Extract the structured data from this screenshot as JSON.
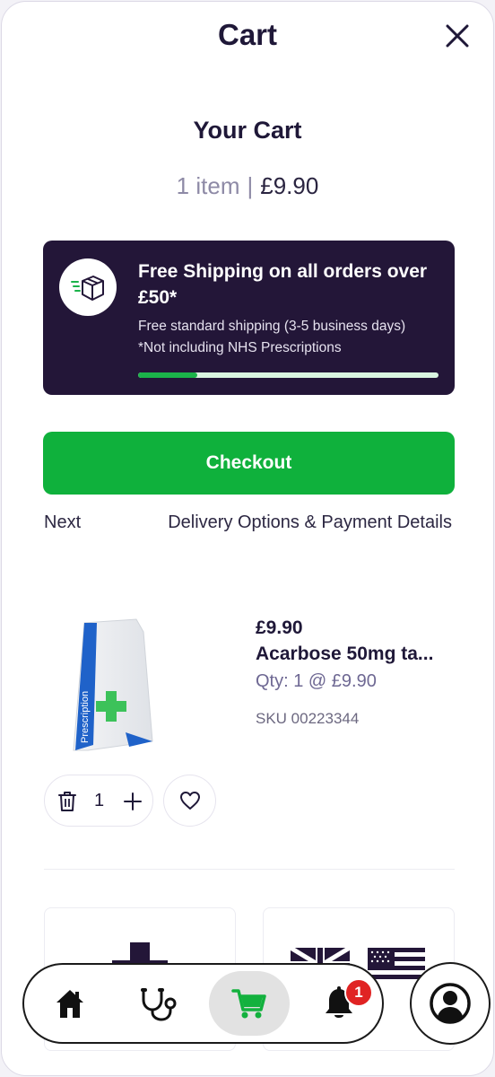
{
  "header": {
    "title": "Cart",
    "close_icon": "close-icon"
  },
  "cart": {
    "heading": "Your Cart",
    "item_count": "1 item",
    "separator": "|",
    "total": "£9.90"
  },
  "shipping_banner": {
    "icon": "delivery-box-icon",
    "title": "Free Shipping on all orders over £50*",
    "line1": "Free standard shipping (3-5 business days)",
    "line2": "*Not including NHS Prescriptions",
    "progress_fraction": 0.198,
    "colors": {
      "background": "#231638",
      "progress_fill": "#1bb34a",
      "progress_track": "#d9f5e0"
    }
  },
  "checkout": {
    "button_label": "Checkout",
    "next_label": "Next",
    "next_detail": "Delivery Options & Payment Details",
    "color": "#0fb13c"
  },
  "item": {
    "image_label": "Prescription",
    "price": "£9.90",
    "name": "Acarbose 50mg ta...",
    "qty_text": "Qty: 1 @ £9.90",
    "sku": "SKU 00223344",
    "quantity": "1"
  },
  "nav": {
    "items": [
      {
        "name": "home",
        "icon": "home-icon"
      },
      {
        "name": "doctor",
        "icon": "stethoscope-icon"
      },
      {
        "name": "cart",
        "icon": "cart-icon",
        "active": true
      },
      {
        "name": "notifications",
        "icon": "bell-icon",
        "badge": "1"
      }
    ],
    "account_icon": "account-icon"
  }
}
